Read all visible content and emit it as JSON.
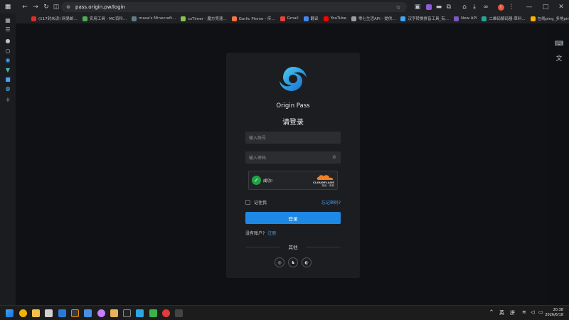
{
  "browser": {
    "url": "pass.origin.pw/login",
    "profile_initial": "!",
    "bookmarks": [
      {
        "label": "(117封未读) 网易邮...",
        "color": "#d93025"
      },
      {
        "label": "实用工具 - MC百科...",
        "color": "#4caf50"
      },
      {
        "label": "masa's Minecraft...",
        "color": "#607d8b"
      },
      {
        "label": "csTimer - 魔方竞速...",
        "color": "#8bc34a"
      },
      {
        "label": "Garlic Phone - 传...",
        "color": "#ff7043"
      },
      {
        "label": "Gmail",
        "color": "#ea4335"
      },
      {
        "label": "翻译",
        "color": "#4285f4"
      },
      {
        "label": "YouTube",
        "color": "#ff0000"
      },
      {
        "label": "零七生活API - 提供...",
        "color": "#9e9e9e"
      },
      {
        "label": "汉字转换拼音工具_有...",
        "color": "#42a5f5"
      },
      {
        "label": "New API",
        "color": "#7e57c2"
      },
      {
        "label": "二维码解码器-草料...",
        "color": "#26a69a"
      },
      {
        "label": "在线ping_多地ping...",
        "color": "#ffb300"
      }
    ]
  },
  "login": {
    "brand": "Origin Pass",
    "heading": "请登录",
    "account_placeholder": "输入账号",
    "password_placeholder": "输入密码",
    "turnstile": {
      "status": "成功!",
      "brand": "CLOUDFLARE",
      "links": "隐私 · 条款"
    },
    "remember_label": "记住我",
    "forgot_label": "忘记密码?",
    "login_button": "登录",
    "no_account": "没有账户?",
    "register": "注册",
    "other": "其他"
  },
  "colors": {
    "accent": "#1e88e5",
    "link": "#4a9fe0",
    "success": "#1ea446",
    "card": "#1c1d21"
  },
  "taskbar": {
    "ime_lang": "英",
    "ime_mode": "拼",
    "time": "20:38",
    "date": "2026/6/18"
  }
}
